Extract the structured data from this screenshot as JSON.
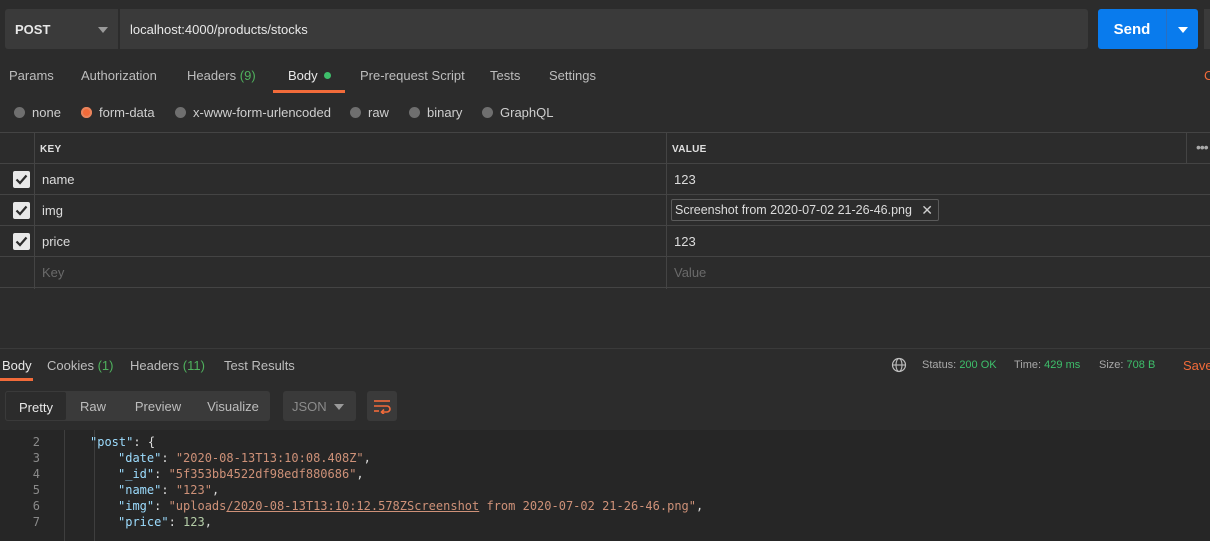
{
  "request": {
    "method": "POST",
    "url": "localhost:4000/products/stocks",
    "send_label": "Send"
  },
  "request_tabs": [
    {
      "label": "Params",
      "count": ""
    },
    {
      "label": "Authorization",
      "count": ""
    },
    {
      "label": "Headers",
      "count": "(9)"
    },
    {
      "label": "Body",
      "count": ""
    },
    {
      "label": "Pre-request Script",
      "count": ""
    },
    {
      "label": "Tests",
      "count": ""
    },
    {
      "label": "Settings",
      "count": ""
    }
  ],
  "active_request_tab": "Body",
  "cut_right_link": "C",
  "body_types": [
    "none",
    "form-data",
    "x-www-form-urlencoded",
    "raw",
    "binary",
    "GraphQL"
  ],
  "selected_body_type": "form-data",
  "form_table": {
    "headers": {
      "key": "KEY",
      "value": "VALUE"
    },
    "rows": [
      {
        "checked": true,
        "key": "name",
        "value": "123",
        "type": "text"
      },
      {
        "checked": true,
        "key": "img",
        "value": "Screenshot from 2020-07-02 21-26-46.png",
        "type": "file"
      },
      {
        "checked": true,
        "key": "price",
        "value": "123",
        "type": "text"
      }
    ],
    "placeholder": {
      "key": "Key",
      "value": "Value"
    }
  },
  "response_tabs": [
    {
      "label": "Body",
      "count": ""
    },
    {
      "label": "Cookies",
      "count": "(1)"
    },
    {
      "label": "Headers",
      "count": "(11)"
    },
    {
      "label": "Test Results",
      "count": ""
    }
  ],
  "response_meta": {
    "status_label": "Status:",
    "status_value": "200 OK",
    "time_label": "Time:",
    "time_value": "429 ms",
    "size_label": "Size:",
    "size_value": "708 B",
    "save_label": "Save"
  },
  "format_buttons": [
    "Pretty",
    "Raw",
    "Preview",
    "Visualize"
  ],
  "active_format": "Pretty",
  "format_type": "JSON",
  "code_lines": [
    {
      "n": "2",
      "key": "\"post\"",
      "sep": ": ",
      "val": "{",
      "vtype": "punct",
      "indent": 0
    },
    {
      "n": "3",
      "key": "\"date\"",
      "sep": ": ",
      "val": "\"2020-08-13T13:10:08.408Z\"",
      "tail": ",",
      "vtype": "str",
      "indent": 1
    },
    {
      "n": "4",
      "key": "\"_id\"",
      "sep": ": ",
      "val": "\"5f353bb4522df98edf880686\"",
      "tail": ",",
      "vtype": "str",
      "indent": 1
    },
    {
      "n": "5",
      "key": "\"name\"",
      "sep": ": ",
      "val": "\"123\"",
      "tail": ",",
      "vtype": "str",
      "indent": 1
    },
    {
      "n": "6",
      "key": "\"img\"",
      "sep": ": ",
      "val_pre": "\"uploads",
      "val_link": "/2020-08-13T13:10:12.578ZScreenshot",
      "val_post": " from 2020-07-02 21-26-46.png\"",
      "tail": ",",
      "vtype": "link",
      "indent": 1
    },
    {
      "n": "7",
      "key": "\"price\"",
      "sep": ": ",
      "val": "123",
      "tail": ",",
      "vtype": "num",
      "indent": 1
    }
  ],
  "colors": {
    "accent": "#f26b3a",
    "send": "#097bed",
    "status_ok": "#3ebf6b",
    "bg": "#2c2c2c"
  },
  "icons": [
    "chevron-down-icon",
    "checkbox-checked-icon",
    "close-icon",
    "globe-icon",
    "wrap-lines-icon",
    "more-horizontal-icon"
  ]
}
